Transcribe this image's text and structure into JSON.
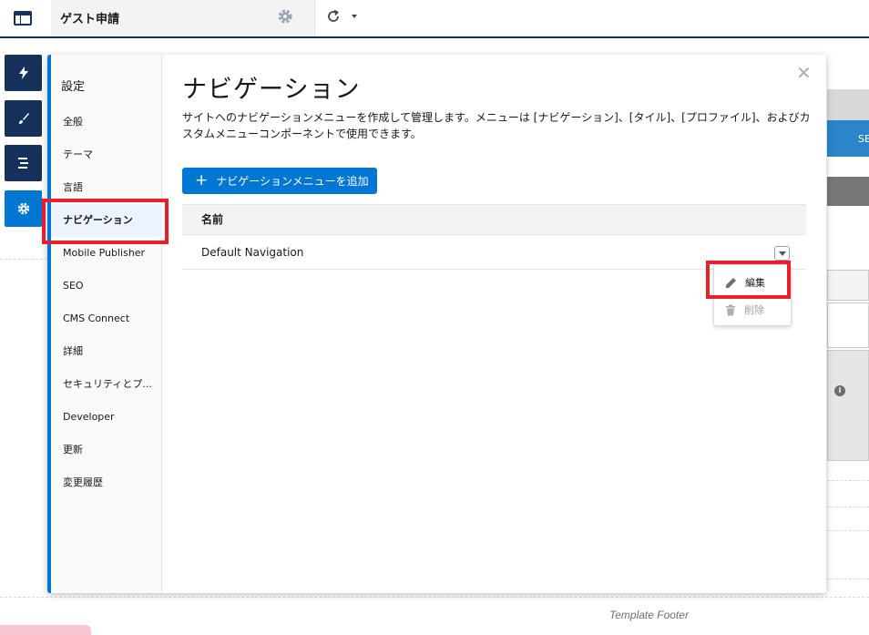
{
  "topbar": {
    "title": "ゲスト申請"
  },
  "canvas": {
    "button_text": "SE",
    "footer_label": "Template Footer"
  },
  "modal": {
    "sidebar_heading": "設定",
    "nav_items": [
      {
        "label": "全般"
      },
      {
        "label": "テーマ"
      },
      {
        "label": "言語"
      },
      {
        "label": "ナビゲーション",
        "active": true
      },
      {
        "label": "Mobile Publisher"
      },
      {
        "label": "SEO"
      },
      {
        "label": "CMS Connect"
      },
      {
        "label": "詳細"
      },
      {
        "label": "セキュリティとプ..."
      },
      {
        "label": "Developer"
      },
      {
        "label": "更新"
      },
      {
        "label": "変更履歴"
      }
    ],
    "title": "ナビゲーション",
    "description": "サイトへのナビゲーションメニューを作成して管理します。メニューは [ナビゲーション]、[タイル]、[プロファイル]、およびカスタムメニューコンポーネントで使用できます。",
    "add_button_label": "ナビゲーションメニューを追加",
    "table": {
      "column_header": "名前",
      "rows": [
        {
          "name": "Default Navigation"
        }
      ]
    },
    "row_menu": {
      "edit_label": "編集",
      "delete_label": "削除"
    }
  },
  "colors": {
    "brand_blue": "#0176d3",
    "dock_navy": "#16325c",
    "highlight_red": "#e8202a"
  },
  "icons": {
    "app": "layout-icon",
    "gear": "gear-icon",
    "refresh": "refresh-icon",
    "dock": [
      "lightning-icon",
      "brush-icon",
      "list-icon",
      "gear-icon"
    ],
    "edit": "pencil-icon",
    "delete": "trash-icon"
  }
}
